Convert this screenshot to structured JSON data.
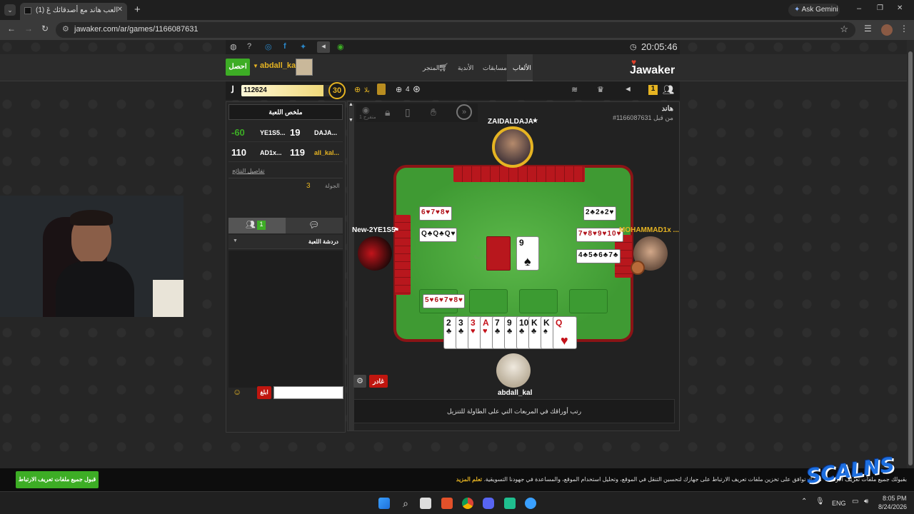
{
  "browser": {
    "tab_title": "(1) العب هاند مع أصدقائك عَ",
    "new_tab": "+",
    "ask_gemini": "Ask Gemini",
    "url": "jawaker.com/ar/games/1166087631",
    "win_min": "–",
    "win_max": "❐",
    "win_close": "✕"
  },
  "site": {
    "clock": "20:05:46",
    "brand": "Jawaker",
    "nav": {
      "games": "الألعاب",
      "tournaments": "مسابقات",
      "clubs": "الأندية",
      "store": "المتجر"
    },
    "user": {
      "name": "abdall_kal",
      "get_button": "احصل"
    },
    "status": {
      "notif_count": "1",
      "coins": "112624",
      "level": "30",
      "vip": "بلا",
      "gems": "4",
      "coin_symbol": "ﻟ"
    }
  },
  "scoreboard": {
    "title": "ملخص اللعبة",
    "rows": [
      {
        "team": "DAJA...",
        "score": "19",
        "opp_team": "YE1S5...",
        "opp_score": "-60"
      },
      {
        "team": "all_kal...",
        "score": "119",
        "opp_team": "AD1x...",
        "opp_score": "110"
      }
    ],
    "details_link": "تفاصيل النتائج",
    "round_label": "الجولة",
    "round_value": "3"
  },
  "chat": {
    "players_count": "1",
    "section_title": "دردشة اللعبة",
    "send_button": "ابلغ",
    "input_placeholder": ""
  },
  "game": {
    "title": "هاند",
    "game_id": "#1166087631 من قبل",
    "spectators": "1 متفرج",
    "players": {
      "top": "ZAIDALDAJA",
      "left": "New-2YE1S5",
      "right": "MOHAMMAD1x ...",
      "bottom": "abdall_kal"
    },
    "meld_top_left": [
      "6♥",
      "7♥",
      "8♥"
    ],
    "meld_top_left_2": [
      "Q♣",
      "Q♣",
      "Q♥"
    ],
    "meld_right_1": [
      "2♣",
      "2♠",
      "2♥"
    ],
    "meld_right_2": [
      "7♥",
      "8♥",
      "9♥",
      "10♥"
    ],
    "meld_right_3": [
      "4♣",
      "5♣",
      "6♣",
      "7♣"
    ],
    "meld_bottom": [
      "5♥",
      "6♥",
      "7♥",
      "8♥"
    ],
    "discard": {
      "rank": "9",
      "suit": "♠"
    },
    "hand": [
      {
        "rank": "2",
        "suit": "♣",
        "red": false
      },
      {
        "rank": "3",
        "suit": "♣",
        "red": false
      },
      {
        "rank": "3",
        "suit": "♥",
        "red": true
      },
      {
        "rank": "A",
        "suit": "♥",
        "red": true
      },
      {
        "rank": "7",
        "suit": "♣",
        "red": false
      },
      {
        "rank": "9",
        "suit": "♣",
        "red": false
      },
      {
        "rank": "10",
        "suit": "♣",
        "red": false
      },
      {
        "rank": "K",
        "suit": "♣",
        "red": false
      },
      {
        "rank": "K",
        "suit": "♠",
        "red": false
      },
      {
        "rank": "Q",
        "suit": "♥",
        "red": true
      }
    ],
    "leave_button": "غادر",
    "instruction": "رتب أوراقك في المربعات التي على الطاولة للتنزيل"
  },
  "cookie": {
    "text": "بقبولك جميع ملفات تعريف الارتباط\" ، فإنك توافق على تخزين ملفات تعريف الارتباط على جهازك لتحسين التنقل في الموقع، وتحليل استخدام الموقع، والمساعدة في جهودنا التسويقية.",
    "learn_more": "تعلم المزيد",
    "accept_button": "قبول جميع ملفات تعريف الارتباط"
  },
  "overlay": {
    "logo_text": "SCALNS"
  },
  "taskbar": {
    "lang": "ENG",
    "time": "8:05 PM",
    "date": "8/24/2026"
  },
  "colors": {
    "felt": "#3f9a33",
    "card_back": "#b8171d",
    "accent_green": "#3dad25",
    "accent_red": "#c0160f",
    "gold": "#e6b422"
  }
}
